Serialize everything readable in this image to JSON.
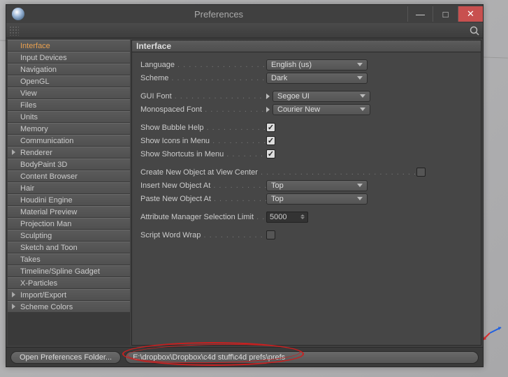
{
  "window": {
    "title": "Preferences"
  },
  "sidebar": {
    "items": [
      {
        "label": "Interface",
        "active": true,
        "expand": false
      },
      {
        "label": "Input Devices",
        "active": false,
        "expand": false
      },
      {
        "label": "Navigation",
        "active": false,
        "expand": false
      },
      {
        "label": "OpenGL",
        "active": false,
        "expand": false
      },
      {
        "label": "View",
        "active": false,
        "expand": false
      },
      {
        "label": "Files",
        "active": false,
        "expand": false
      },
      {
        "label": "Units",
        "active": false,
        "expand": false
      },
      {
        "label": "Memory",
        "active": false,
        "expand": false
      },
      {
        "label": "Communication",
        "active": false,
        "expand": false
      },
      {
        "label": "Renderer",
        "active": false,
        "expand": true
      },
      {
        "label": "BodyPaint 3D",
        "active": false,
        "expand": false
      },
      {
        "label": "Content Browser",
        "active": false,
        "expand": false
      },
      {
        "label": "Hair",
        "active": false,
        "expand": false
      },
      {
        "label": "Houdini Engine",
        "active": false,
        "expand": false
      },
      {
        "label": "Material Preview",
        "active": false,
        "expand": false
      },
      {
        "label": "Projection Man",
        "active": false,
        "expand": false
      },
      {
        "label": "Sculpting",
        "active": false,
        "expand": false
      },
      {
        "label": "Sketch and Toon",
        "active": false,
        "expand": false
      },
      {
        "label": "Takes",
        "active": false,
        "expand": false
      },
      {
        "label": "Timeline/Spline Gadget",
        "active": false,
        "expand": false
      },
      {
        "label": "X-Particles",
        "active": false,
        "expand": false
      },
      {
        "label": "Import/Export",
        "active": false,
        "expand": true
      },
      {
        "label": "Scheme Colors",
        "active": false,
        "expand": true
      }
    ]
  },
  "panel": {
    "header": "Interface",
    "language": {
      "label": "Language",
      "value": "English (us)"
    },
    "scheme": {
      "label": "Scheme",
      "value": "Dark"
    },
    "gui_font": {
      "label": "GUI Font",
      "value": "Segoe UI"
    },
    "mono_font": {
      "label": "Monospaced Font",
      "value": "Courier New"
    },
    "show_bubble": {
      "label": "Show Bubble Help",
      "checked": true
    },
    "show_icons": {
      "label": "Show Icons in Menu",
      "checked": true
    },
    "show_shortcuts": {
      "label": "Show Shortcuts in Menu",
      "checked": true
    },
    "create_center": {
      "label": "Create New Object at View Center",
      "checked": false
    },
    "insert_at": {
      "label": "Insert New Object At",
      "value": "Top"
    },
    "paste_at": {
      "label": "Paste New Object At",
      "value": "Top"
    },
    "attr_limit": {
      "label": "Attribute Manager Selection Limit",
      "value": "5000"
    },
    "script_wrap": {
      "label": "Script Word Wrap",
      "checked": false
    }
  },
  "footer": {
    "open_button": "Open Preferences Folder...",
    "path": "E:\\dropbox\\Dropbox\\c4d stuff\\c4d prefs\\prefs"
  }
}
